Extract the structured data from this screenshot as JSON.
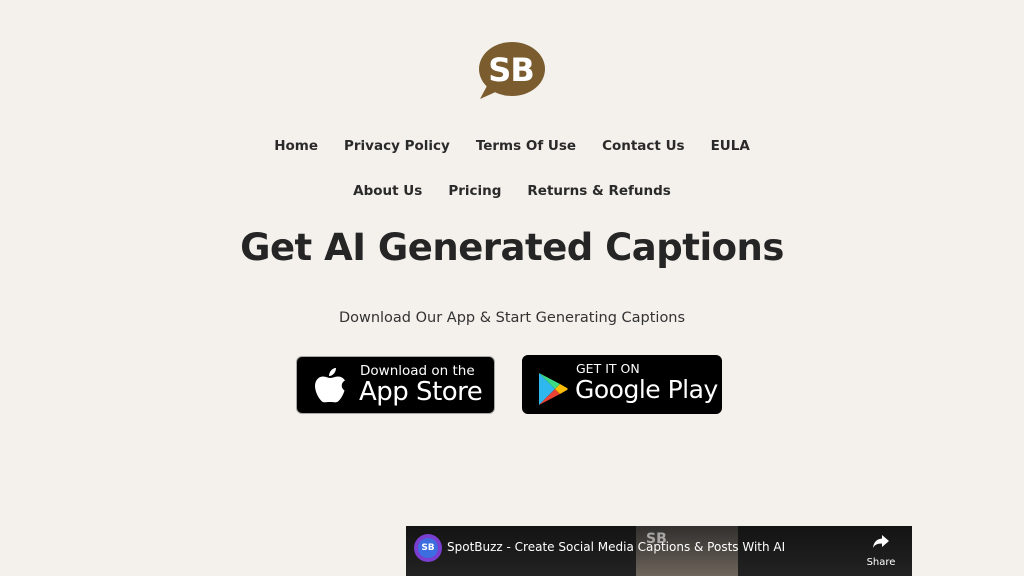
{
  "logo": {
    "text": "SB",
    "color": "#7a5c2e"
  },
  "nav": {
    "row1": [
      "Home",
      "Privacy Policy",
      "Terms Of Use",
      "Contact Us",
      "EULA"
    ],
    "row2": [
      "About Us",
      "Pricing",
      "Returns & Refunds"
    ]
  },
  "hero": {
    "headline": "Get AI Generated Captions",
    "subline": "Download Our App & Start Generating Captions"
  },
  "app_store": {
    "small": "Download on the",
    "big": "App Store",
    "icon": "apple-icon"
  },
  "google_play": {
    "small": "GET IT ON",
    "big": "Google Play",
    "icon": "google-play-icon"
  },
  "video": {
    "channel_badge": "SB",
    "title": "SpotBuzz - Create Social Media Captions & Posts With AI",
    "watermark": "SB",
    "share_label": "Share"
  }
}
